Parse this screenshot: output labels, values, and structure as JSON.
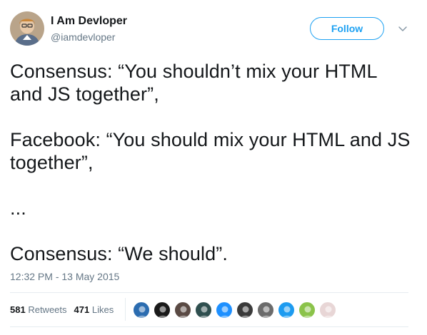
{
  "author": {
    "display_name": "I Am Devloper",
    "handle": "@iamdevloper",
    "avatar_icon": "person-avatar"
  },
  "follow": {
    "label": "Follow"
  },
  "tweet": {
    "paragraphs": [
      "Consensus: “You shouldn’t mix your HTML\nand JS together”,",
      "Facebook: “You should mix your HTML and JS\ntogether”,",
      "...",
      "Consensus: “We should”."
    ]
  },
  "timestamp": "12:32 PM - 13 May 2015",
  "stats": {
    "retweets_count": "581",
    "retweets_label": "Retweets",
    "likes_count": "471",
    "likes_label": "Likes"
  },
  "likers": [
    {
      "icon": "liker-avatar-1",
      "color": "#2b6cb0"
    },
    {
      "icon": "liker-avatar-2",
      "color": "#1a1a1a"
    },
    {
      "icon": "liker-avatar-3",
      "color": "#5a4a44"
    },
    {
      "icon": "liker-avatar-4",
      "color": "#2f4f4f"
    },
    {
      "icon": "liker-avatar-5",
      "color": "#1e90ff"
    },
    {
      "icon": "liker-avatar-6",
      "color": "#3a3a3a"
    },
    {
      "icon": "liker-avatar-7",
      "color": "#6b6b6b"
    },
    {
      "icon": "liker-avatar-8",
      "color": "#1d9bf0"
    },
    {
      "icon": "liker-avatar-9",
      "color": "#8bc34a"
    },
    {
      "icon": "liker-avatar-10",
      "color": "#e8d6d6"
    }
  ],
  "colors": {
    "accent": "#1da1f2",
    "text": "#14171a",
    "muted": "#657786",
    "border": "#e6ecf0"
  }
}
